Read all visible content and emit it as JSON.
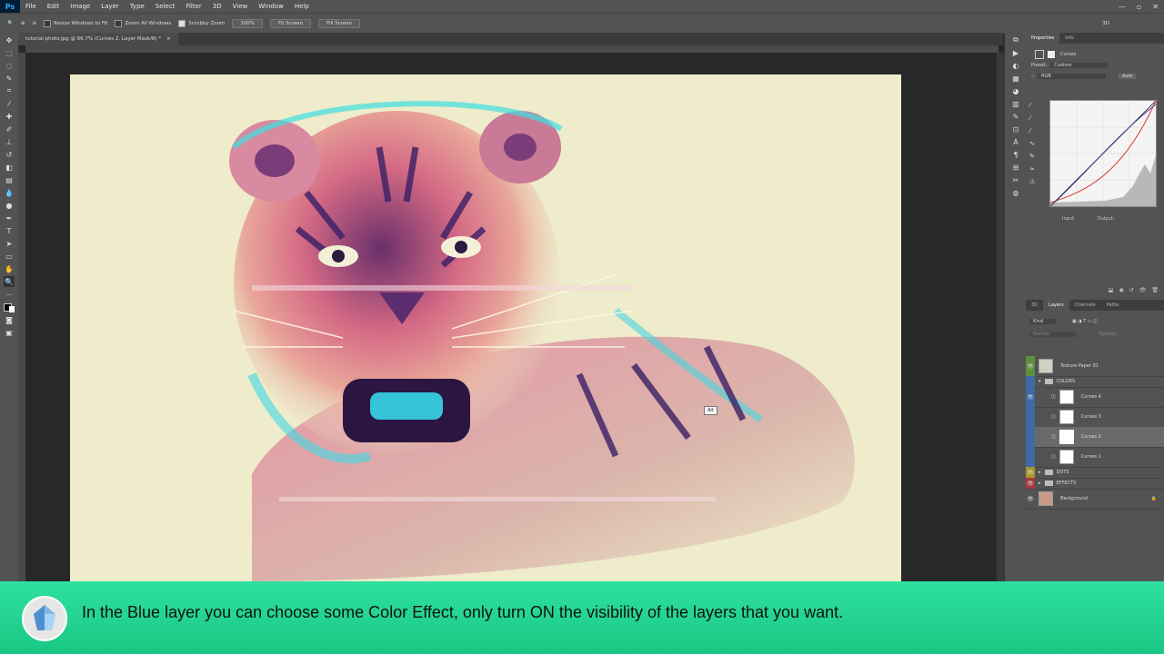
{
  "app": {
    "logo": "Ps"
  },
  "menu": [
    "File",
    "Edit",
    "Image",
    "Layer",
    "Type",
    "Select",
    "Filter",
    "3D",
    "View",
    "Window",
    "Help"
  ],
  "options": {
    "resize_windows": "Resize Windows to Fit",
    "zoom_all": "Zoom All Windows",
    "scrubby_zoom": "Scrubby Zoom",
    "btn_100": "100%",
    "btn_fit": "Fit Screen",
    "btn_fill": "Fill Screen",
    "workspace": "3D"
  },
  "document": {
    "tab": "tutorial photo.jpg @ 66.7% (Curves 2, Layer Mask/8) *"
  },
  "properties": {
    "tabs": [
      "Properties",
      "Info"
    ],
    "title": "Curves",
    "preset_label": "Preset:",
    "preset_value": "Custom",
    "channel": "RGB",
    "auto": "Auto",
    "input_label": "Input:",
    "output_label": "Output:"
  },
  "layers_panel": {
    "tabs": [
      "3D",
      "Layers",
      "Channels",
      "Paths"
    ],
    "filter": "Kind",
    "blend": "Normal",
    "opacity_label": "Opacity:",
    "layers": [
      {
        "name": "Texture Paper 01"
      },
      {
        "name": "COLORS"
      },
      {
        "name": "Curves 4"
      },
      {
        "name": "Curves 3"
      },
      {
        "name": "Curves 2"
      },
      {
        "name": "Curves 1"
      },
      {
        "name": "DOTS"
      },
      {
        "name": "EFFECTS"
      },
      {
        "name": "Background"
      }
    ]
  },
  "tooltip": "Alt",
  "caption": "In the Blue layer you can choose some Color Effect, only turn ON the visibility of the layers that you want.",
  "colors": {
    "accent": "#1ecf8c",
    "canvas_bg": "#eeeccb"
  }
}
